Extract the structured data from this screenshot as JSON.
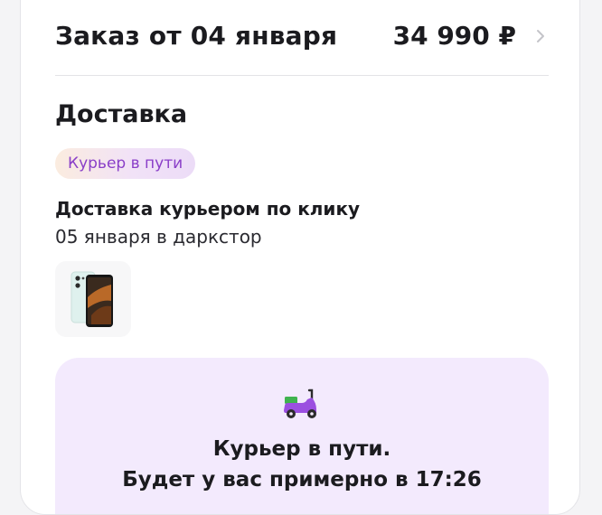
{
  "order": {
    "title": "Заказ от 04 января",
    "total": "34 990 ₽"
  },
  "delivery": {
    "section_title": "Доставка",
    "status_badge": "Курьер в пути",
    "method": "Доставка курьером по клику",
    "date": "05 января в даркстор"
  },
  "product": {
    "icon": "smartphone-thumbnail"
  },
  "status_panel": {
    "icon": "scooter-icon",
    "line1": "Курьер в пути.",
    "line2": "Будет у вас примерно в 17:26"
  },
  "colors": {
    "accent": "#8a3fc8",
    "panel_bg": "#f3eafd",
    "scooter_green": "#3fb34f"
  }
}
